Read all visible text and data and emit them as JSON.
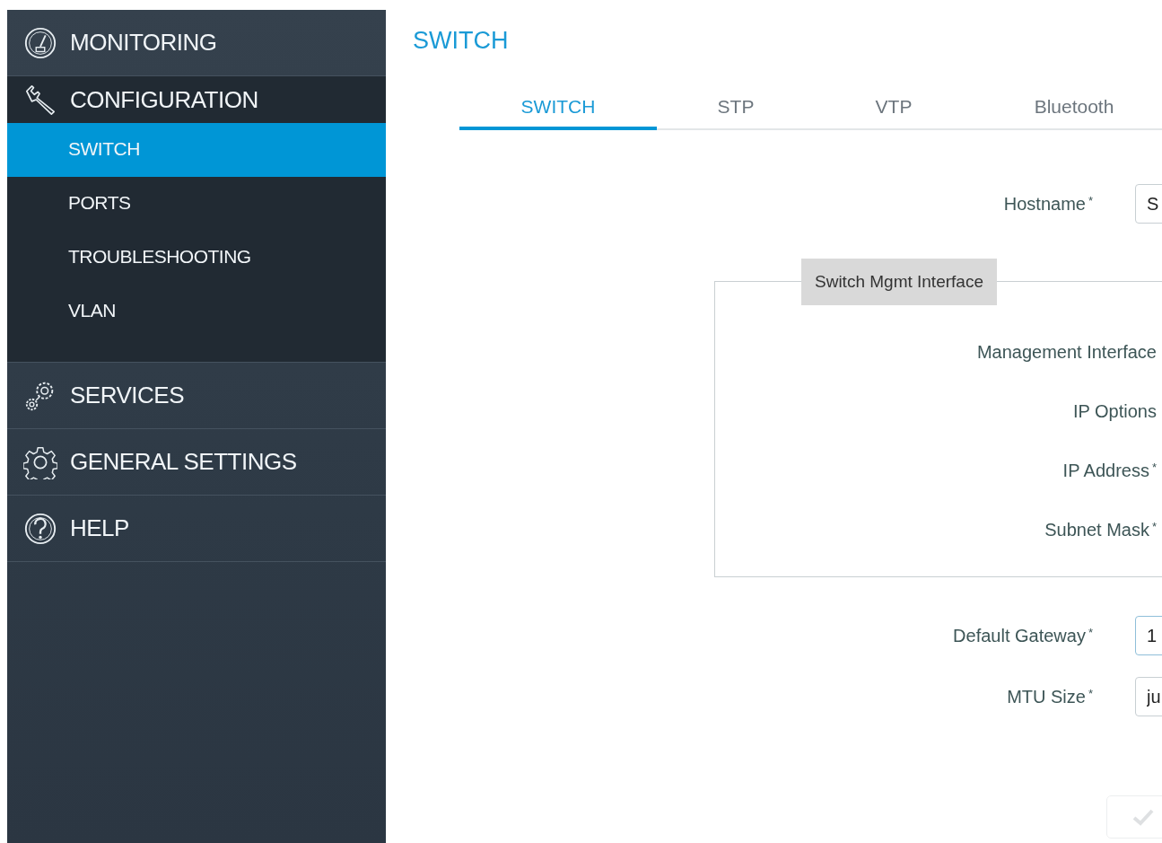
{
  "sidebar": {
    "sections": [
      {
        "label": "MONITORING",
        "expanded": false
      },
      {
        "label": "CONFIGURATION",
        "expanded": true,
        "children": [
          {
            "label": "SWITCH",
            "selected": true
          },
          {
            "label": "PORTS",
            "selected": false
          },
          {
            "label": "TROUBLESHOOTING",
            "selected": false
          },
          {
            "label": "VLAN",
            "selected": false
          }
        ]
      },
      {
        "label": "SERVICES",
        "expanded": false
      },
      {
        "label": "GENERAL SETTINGS",
        "expanded": false
      },
      {
        "label": "HELP",
        "expanded": false
      }
    ]
  },
  "page_title": "SWITCH",
  "tabs": [
    {
      "label": "SWITCH",
      "selected": true
    },
    {
      "label": "STP",
      "selected": false
    },
    {
      "label": "VTP",
      "selected": false
    },
    {
      "label": "Bluetooth",
      "selected": false
    }
  ],
  "form": {
    "fields_before": [
      {
        "label": "Hostname",
        "required_mark": "*",
        "value": "S"
      }
    ],
    "fieldset": {
      "legend": "Switch Mgmt Interface",
      "fields": [
        {
          "label": "Management Interface"
        },
        {
          "label": "IP Options"
        },
        {
          "label": "IP Address",
          "required_mark": "*"
        },
        {
          "label": "Subnet Mask",
          "required_mark": "*"
        }
      ]
    },
    "fields_after": [
      {
        "label": "Default Gateway",
        "required_mark": "*",
        "value": "1",
        "focused": true
      },
      {
        "label": "MTU Size",
        "required_mark": "*",
        "value": "ju",
        "focused": false
      }
    ],
    "apply_button": {
      "disabled": true
    }
  }
}
